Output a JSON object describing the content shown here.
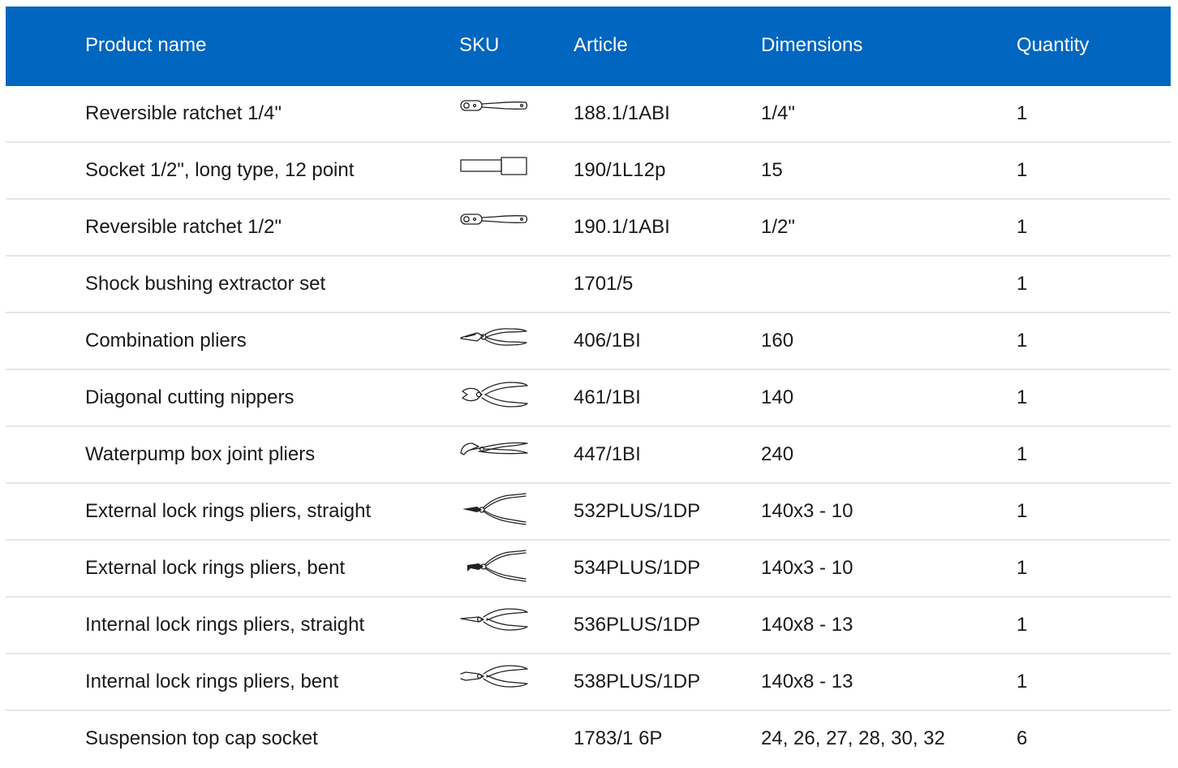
{
  "table": {
    "headers": {
      "name": "Product name",
      "sku": "SKU",
      "article": "Article",
      "dimensions": "Dimensions",
      "quantity": "Quantity"
    },
    "rows": [
      {
        "name": "Reversible ratchet 1/4\"",
        "sku_icon": "ratchet-icon",
        "article": "188.1/1ABI",
        "dimensions": "1/4\"",
        "quantity": "1"
      },
      {
        "name": "Socket 1/2\", long type, 12 point",
        "sku_icon": "socket-icon",
        "article": "190/1L12p",
        "dimensions": "15",
        "quantity": "1"
      },
      {
        "name": "Reversible ratchet 1/2\"",
        "sku_icon": "ratchet-icon",
        "article": "190.1/1ABI",
        "dimensions": "1/2\"",
        "quantity": "1"
      },
      {
        "name": "Shock bushing extractor set",
        "sku_icon": "",
        "article": "1701/5",
        "dimensions": "",
        "quantity": "1"
      },
      {
        "name": "Combination pliers",
        "sku_icon": "combination-pliers-icon",
        "article": "406/1BI",
        "dimensions": "160",
        "quantity": "1"
      },
      {
        "name": "Diagonal cutting nippers",
        "sku_icon": "diagonal-nippers-icon",
        "article": "461/1BI",
        "dimensions": "140",
        "quantity": "1"
      },
      {
        "name": "Waterpump box joint pliers",
        "sku_icon": "waterpump-pliers-icon",
        "article": "447/1BI",
        "dimensions": "240",
        "quantity": "1"
      },
      {
        "name": "External lock rings pliers, straight",
        "sku_icon": "external-ring-pliers-straight-icon",
        "article": "532PLUS/1DP",
        "dimensions": "140x3 - 10",
        "quantity": "1"
      },
      {
        "name": "External lock rings pliers, bent",
        "sku_icon": "external-ring-pliers-bent-icon",
        "article": "534PLUS/1DP",
        "dimensions": "140x3 - 10",
        "quantity": "1"
      },
      {
        "name": "Internal lock rings pliers, straight",
        "sku_icon": "internal-ring-pliers-straight-icon",
        "article": "536PLUS/1DP",
        "dimensions": "140x8 - 13",
        "quantity": "1"
      },
      {
        "name": "Internal lock rings pliers, bent",
        "sku_icon": "internal-ring-pliers-bent-icon",
        "article": "538PLUS/1DP",
        "dimensions": "140x8 - 13",
        "quantity": "1"
      },
      {
        "name": "Suspension top cap socket",
        "sku_icon": "",
        "article": "1783/1 6P",
        "dimensions": "24, 26, 27, 28, 30, 32",
        "quantity": "6"
      }
    ]
  },
  "colors": {
    "header_background": "#0066c0",
    "header_text": "#ffffff",
    "row_divider": "#e6e6e6"
  }
}
